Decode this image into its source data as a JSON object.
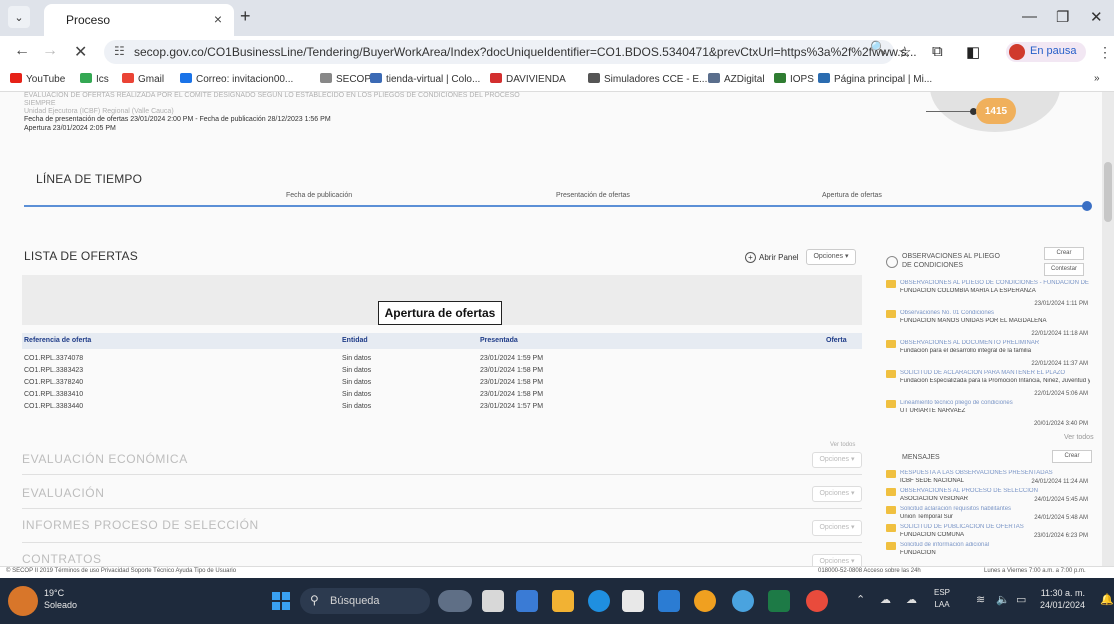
{
  "browser": {
    "tab_title": "Proceso",
    "tab_close": "×",
    "new_tab": "+",
    "url": "secop.gov.co/CO1BusinessLine/Tendering/BuyerWorkArea/Index?docUniqueIdentifier=CO1.BDOS.5340471&prevCtxUrl=https%3a%2f%2fwww.s...",
    "profile_status": "En pausa",
    "window_controls": {
      "minimize": "—",
      "restore": "❐",
      "close": "✕"
    }
  },
  "bookmarks": [
    {
      "label": "YouTube",
      "color": "#e62117"
    },
    {
      "label": "Ics",
      "color": "#34a853"
    },
    {
      "label": "Gmail",
      "color": "#ea4335"
    },
    {
      "label": "Correo: invitacion00...",
      "color": "#1a73e8"
    },
    {
      "label": "SECOP II",
      "color": "#888888"
    },
    {
      "label": "tienda-virtual | Colo...",
      "color": "#3b6ab5"
    },
    {
      "label": "DAVIVIENDA",
      "color": "#d32f2f"
    },
    {
      "label": "Simuladores CCE - E...",
      "color": "#555555"
    },
    {
      "label": "AZDigital",
      "color": "#5a6e8c"
    },
    {
      "label": "IOPS",
      "color": "#2f7d32"
    },
    {
      "label": "Página principal | Mi...",
      "color": "#2b6cb0"
    }
  ],
  "page": {
    "header_faint_1": "EVALUACIÓN DE OFERTAS REALIZADA POR EL COMITÉ DESIGNADO SEGÚN LO ESTABLECIDO EN LOS PLIEGOS DE CONDICIONES DEL PROCESO",
    "header_faint_2": "SIEMPRE",
    "entity_faint": "Unidad Ejecutora (ICBF) Regional (Valle Cauca)",
    "dates_line": "Fecha de presentación de ofertas 23/01/2024 2:00 PM  -  Fecha de publicación 28/12/2023 1:56 PM",
    "apertura_line": "Apertura 23/01/2024 2:05 PM",
    "badge": "1415",
    "timeline_title": "LÍNEA DE TIEMPO",
    "timeline_labels": [
      "Fecha de publicación",
      "Presentación de ofertas",
      "Apertura de ofertas"
    ],
    "offers_title": "LISTA DE OFERTAS",
    "abrir_panel": "Abrir Panel",
    "opciones": "Opciones",
    "tooltip": "Apertura de ofertas",
    "table_headers": [
      "Referencia de oferta",
      "Entidad",
      "Presentada",
      "Oferta"
    ],
    "table_rows": [
      {
        "ref": "CO1.RPL.3374078",
        "entidad": "Sin datos",
        "presentada": "23/01/2024 1:59 PM"
      },
      {
        "ref": "CO1.RPL.3383423",
        "entidad": "Sin datos",
        "presentada": "23/01/2024 1:58 PM"
      },
      {
        "ref": "CO1.RPL.3378240",
        "entidad": "Sin datos",
        "presentada": "23/01/2024 1:58 PM"
      },
      {
        "ref": "CO1.RPL.3383410",
        "entidad": "Sin datos",
        "presentada": "23/01/2024 1:58 PM"
      },
      {
        "ref": "CO1.RPL.3383440",
        "entidad": "Sin datos",
        "presentada": "23/01/2024 1:57 PM"
      }
    ],
    "pager": "Ver todos",
    "sections": [
      "EVALUACIÓN ECONÓMICA",
      "EVALUACIÓN",
      "INFORMES PROCESO DE SELECCIÓN",
      "CONTRATOS"
    ]
  },
  "side": {
    "obs_title": "OBSERVACIONES AL PLIEGO DE CONDICIONES",
    "btn_crear": "Crear",
    "btn_contestar": "Contestar",
    "observations": [
      {
        "link": "OBSERVACIONES AL PLIEGO DE CONDICIONES - FUNDACIÓN DE PARA",
        "name": "FUNDACION COLOMBIA MARIA LA ESPERANZA",
        "date": "23/01/2024 1:11 PM"
      },
      {
        "link": "Observaciones No. 01 Condiciones",
        "name": "FUNDACION MANOS UNIDAS POR EL MAGDALENA",
        "date": "22/01/2024 11:18 AM"
      },
      {
        "link": "OBSERVACIONES AL DOCUMENTO PRELIMINAR",
        "name": "Fundación para el desarrollo integral de la familia",
        "date": "22/01/2024 11:37 AM"
      },
      {
        "link": "SOLICITUD DE ACLARACIÓN PARA MANTENER EL PLAZO",
        "name": "Fundación Especializada para la Promoción Infancia, Niñez, Juventud y Familia",
        "date": "22/01/2024 5:06 AM"
      },
      {
        "link": "Lineamiento técnico pliego de condiciones",
        "name": "UT URIARTE NARVAEZ",
        "date": "20/01/2024 3:40 PM"
      }
    ],
    "obs_more": "Ver todos",
    "messages_title": "MENSAJES",
    "btn_crear_msg": "Crear",
    "messages": [
      {
        "link": "RESPUESTA A LAS OBSERVACIONES PRESENTADAS",
        "name": "ICBF SEDE NACIONAL",
        "date": "24/01/2024 11:24 AM"
      },
      {
        "link": "OBSERVACIONES AL PROCESO DE SELECCIÓN",
        "name": "ASOCIACION VISIONAR",
        "date": "24/01/2024 5:45 AM"
      },
      {
        "link": "Solicitud aclaración requisitos habilitantes",
        "name": "Union Temporal Sur",
        "date": "24/01/2024 5:48 AM"
      },
      {
        "link": "SOLICITUD DE PUBLICACIÓN DE OFERTAS",
        "name": "FUNDACION COMUNA",
        "date": "23/01/2024 6:23 PM"
      },
      {
        "link": "Solicitud de información adicional",
        "name": "FUNDACION",
        "date": ""
      }
    ]
  },
  "footer": {
    "left": "© SECOP II 2019   Términos de uso   Privacidad   Soporte Técnico   Ayuda   Tipo de Usuario",
    "right": "018000-52-0808   Acceso sobre las 24h",
    "hours": "Lunes a Viernes 7:00 a.m. a 7:00 p.m."
  },
  "taskbar": {
    "weather_temp": "19°C",
    "weather_desc": "Soleado",
    "search_placeholder": "Búsqueda",
    "lang_1": "ESP",
    "lang_2": "LAA",
    "time": "11:30 a. m.",
    "date": "24/01/2024"
  }
}
